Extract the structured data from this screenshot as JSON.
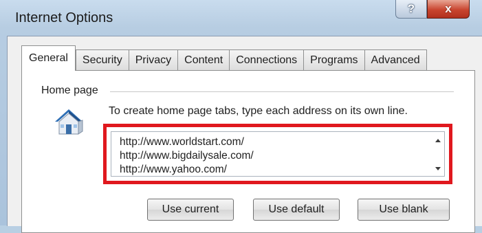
{
  "window": {
    "title": "Internet Options",
    "help_label": "?",
    "close_label": "x"
  },
  "tabs": [
    {
      "label": "General",
      "active": true
    },
    {
      "label": "Security",
      "active": false
    },
    {
      "label": "Privacy",
      "active": false
    },
    {
      "label": "Content",
      "active": false
    },
    {
      "label": "Connections",
      "active": false
    },
    {
      "label": "Programs",
      "active": false
    },
    {
      "label": "Advanced",
      "active": false
    }
  ],
  "home_page": {
    "group_label": "Home page",
    "icon": "house-icon",
    "instructions": "To create home page tabs, type each address on its own line.",
    "urls": [
      "http://www.worldstart.com/",
      "http://www.bigdailysale.com/",
      "http://www.yahoo.com/"
    ],
    "highlight_color": "#e0181e",
    "buttons": {
      "use_current": "Use current",
      "use_default": "Use default",
      "use_blank": "Use blank"
    }
  }
}
